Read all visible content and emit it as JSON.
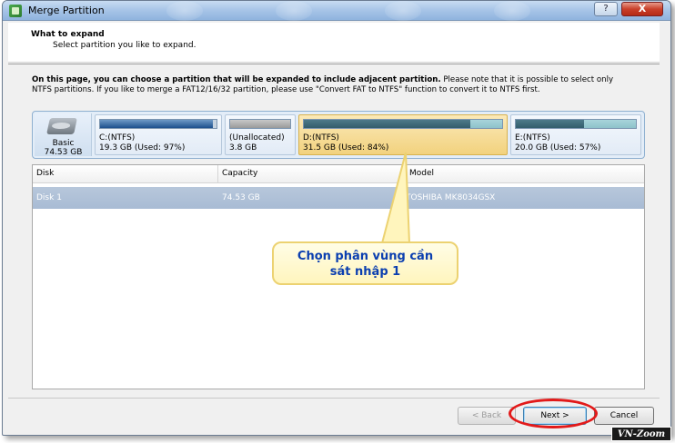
{
  "window": {
    "title": "Merge Partition",
    "help_label": "?",
    "close_label": "X"
  },
  "header": {
    "title": "What to expand",
    "subtitle": "Select partition you like to expand."
  },
  "description": {
    "bold": "On this page, you can choose a partition that will be expanded to include adjacent partition.",
    "rest": " Please note that it is possible to select only NTFS partitions. If you like to merge a FAT12/16/32 partition, please use \"Convert FAT to NTFS\" function to convert it to NTFS first."
  },
  "disk_map": {
    "disk_type": "Basic",
    "disk_size": "74.53 GB",
    "partitions": [
      {
        "name": "C:(NTFS)",
        "info": "19.3 GB (Used: 97%)",
        "used_fraction": 0.97,
        "color": "#1d4f8c",
        "selected": false
      },
      {
        "name": "(Unallocated)",
        "info": "3.8 GB",
        "used_fraction": 1.0,
        "color": "#9a9a9a",
        "selected": false
      },
      {
        "name": "D:(NTFS)",
        "info": "31.5 GB (Used: 84%)",
        "used_fraction": 0.84,
        "color": "#335d6b",
        "selected": true
      },
      {
        "name": "E:(NTFS)",
        "info": "20.0 GB (Used: 57%)",
        "used_fraction": 0.57,
        "color": "#335d6b",
        "selected": false
      }
    ]
  },
  "table": {
    "columns": [
      "Disk",
      "Capacity",
      "Model"
    ],
    "rows": [
      {
        "disk": "Disk 1",
        "capacity": "74.53 GB",
        "model": "TOSHIBA MK8034GSX"
      }
    ]
  },
  "buttons": {
    "back": "< Back",
    "next": "Next >",
    "cancel": "Cancel"
  },
  "annotation": {
    "line1": "Chọn phân vùng cần",
    "line2": "sát nhập 1"
  },
  "watermark": "VN-Zoom"
}
